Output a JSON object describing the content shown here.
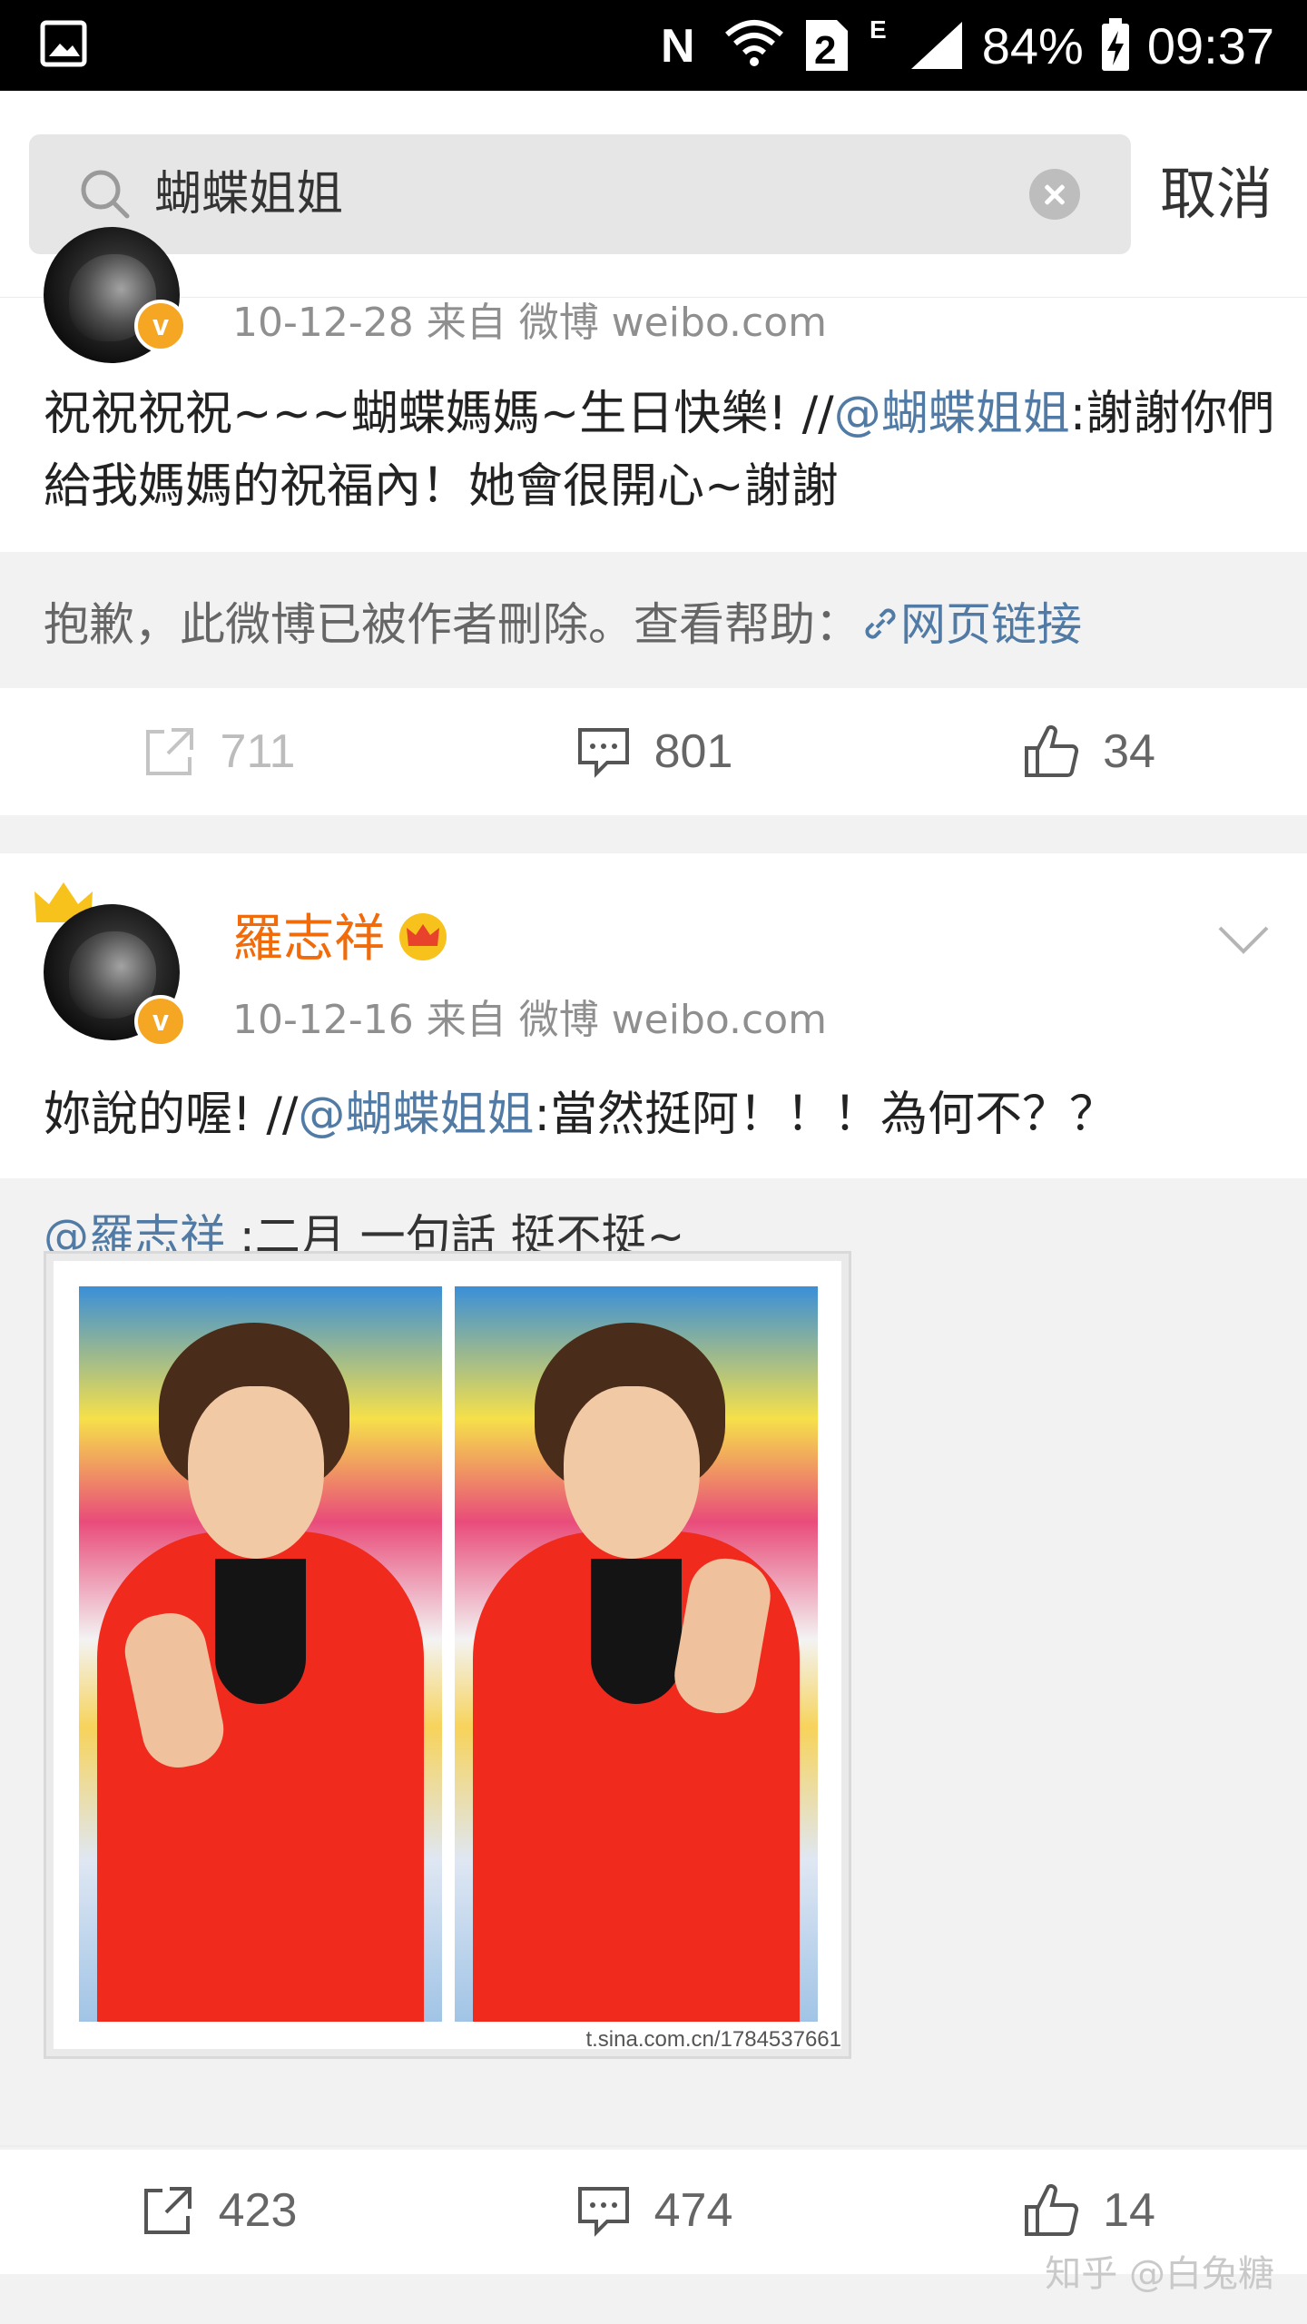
{
  "status_bar": {
    "icons": [
      "image-icon",
      "nfc-icon",
      "wifi-icon",
      "sim2-icon",
      "e-network-icon",
      "signal-icon",
      "battery-charging-icon"
    ],
    "battery": "84%",
    "time": "09:37"
  },
  "search": {
    "query": "蝴蝶姐姐",
    "cancel_label": "取消"
  },
  "posts": [
    {
      "meta": "10-12-28   来自 微博 weibo.com",
      "text_prefix": "祝祝祝祝~~~蝴蝶媽媽~生日快樂! //",
      "text_mention": "@蝴蝶姐姐",
      "text_suffix": ":謝謝你們給我媽媽的祝福內！她會很開心~謝謝",
      "deleted_text": "抱歉，此微博已被作者刪除。查看帮助：",
      "deleted_link": "网页链接",
      "repost_count": "711",
      "comment_count": "801",
      "like_count": "34"
    },
    {
      "username": "羅志祥",
      "meta": "10-12-16   来自 微博 weibo.com",
      "text_prefix": "妳說的喔! //",
      "text_mention": "@蝴蝶姐姐",
      "text_suffix": ":當然挺阿！！！為何不？？",
      "quote_mention": "@羅志祥",
      "quote_text": " :二月 一句話  挺不挺~",
      "image_watermark": "t.sina.com.cn/1784537661",
      "repost_count": "423",
      "comment_count": "474",
      "like_count": "14"
    }
  ],
  "watermark": "知乎 @白兔糖",
  "colors": {
    "link": "#517ba5",
    "username": "#f26b0a",
    "verified_badge": "#f5a623"
  }
}
